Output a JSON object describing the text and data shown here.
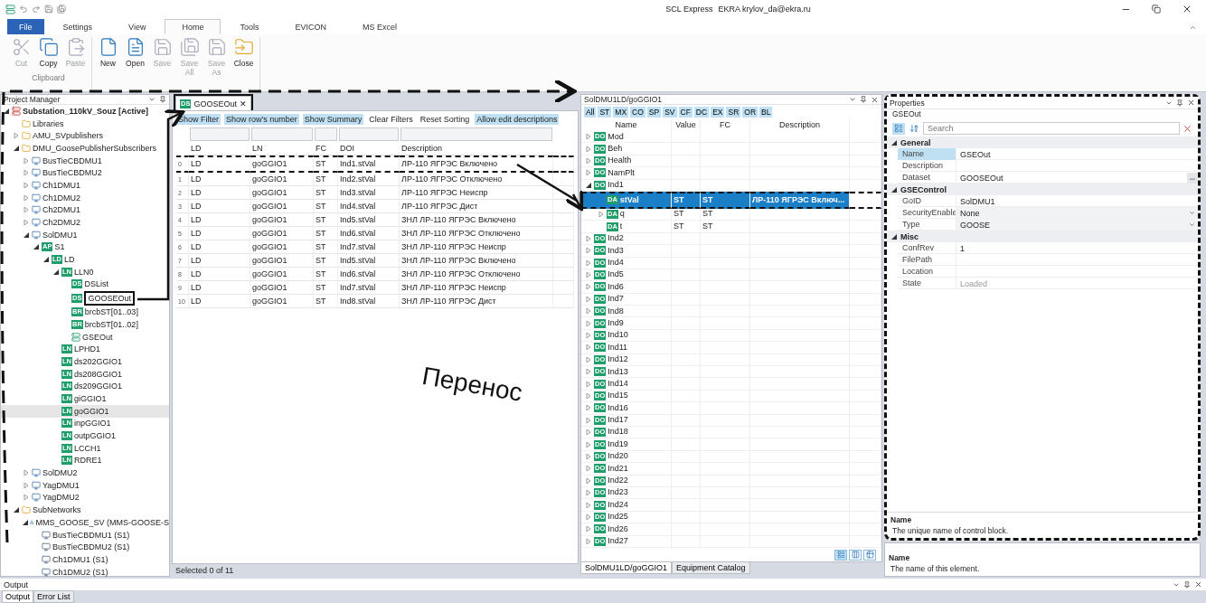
{
  "window": {
    "app": "SCL Express",
    "user": "EKRA krylov_da@ekra.ru"
  },
  "ribbon_tabs": [
    {
      "label": "File",
      "kind": "file",
      "selected": false
    },
    {
      "label": "Settings",
      "kind": "tab",
      "selected": false
    },
    {
      "label": "View",
      "kind": "tab",
      "selected": false
    },
    {
      "label": "Home",
      "kind": "tab",
      "selected": true
    },
    {
      "label": "Tools",
      "kind": "tab",
      "selected": false
    },
    {
      "label": "EVICON",
      "kind": "tab",
      "selected": false
    },
    {
      "label": "MS Excel",
      "kind": "tab",
      "selected": false
    }
  ],
  "ribbon_groups": [
    {
      "label": "Clipboard",
      "buttons": [
        {
          "label": "Cut",
          "kind": "cut",
          "disabled": true
        },
        {
          "label": "Copy",
          "kind": "copy",
          "disabled": false
        },
        {
          "label": "Paste",
          "kind": "paste",
          "disabled": true
        }
      ]
    },
    {
      "buttons": [
        {
          "label": "New",
          "kind": "new",
          "disabled": false
        },
        {
          "label": "Open",
          "kind": "open",
          "disabled": false
        },
        {
          "label": "Save",
          "kind": "save",
          "disabled": true
        },
        {
          "label": "Save All",
          "kind": "saveall",
          "disabled": true
        },
        {
          "label": "Save As",
          "kind": "save",
          "disabled": true
        },
        {
          "label": "Close",
          "kind": "close",
          "disabled": false
        }
      ]
    }
  ],
  "project_manager": {
    "title": "Project Manager",
    "tree": [
      {
        "label": "Substation_110kV_Souz [Active]",
        "kind": "substation",
        "expanded": true,
        "selected": false,
        "children": [
          {
            "label": "Libraries",
            "kind": "folder",
            "selected": false
          },
          {
            "label": "AMU_SVpublishers",
            "kind": "folder",
            "expanded": false,
            "selected": false
          },
          {
            "label": "DMU_GoosePublisherSubscribers",
            "kind": "folder",
            "expanded": true,
            "selected": false,
            "children": [
              {
                "label": "BusTieCBDMU1",
                "kind": "ied",
                "expanded": false,
                "selected": false
              },
              {
                "label": "BusTieCBDMU2",
                "kind": "ied",
                "expanded": false,
                "selected": false
              },
              {
                "label": "Ch1DMU1",
                "kind": "ied",
                "expanded": false,
                "selected": false
              },
              {
                "label": "Ch1DMU2",
                "kind": "ied",
                "expanded": false,
                "selected": false
              },
              {
                "label": "Ch2DMU1",
                "kind": "ied",
                "expanded": false,
                "selected": false
              },
              {
                "label": "Ch2DMU2",
                "kind": "ied",
                "expanded": false,
                "selected": false
              },
              {
                "label": "SolDMU1",
                "kind": "ied",
                "expanded": true,
                "selected": false,
                "children": [
                  {
                    "label": "S1",
                    "badge": "AP",
                    "expanded": true,
                    "selected": false,
                    "children": [
                      {
                        "label": "LD",
                        "badge": "LD",
                        "expanded": true,
                        "selected": false,
                        "children": [
                          {
                            "label": "LLN0",
                            "badge": "LN",
                            "expanded": true,
                            "selected": false,
                            "children": [
                              {
                                "label": "DSList",
                                "badge": "DS",
                                "selected": false
                              },
                              {
                                "label": "GOOSEOut",
                                "badge": "DS",
                                "selected": false,
                                "framed": true
                              },
                              {
                                "label": "brcbST[01..03]",
                                "badge": "BR",
                                "selected": false
                              },
                              {
                                "label": "brcbST[01..02]",
                                "badge": "BR",
                                "selected": false
                              },
                              {
                                "label": "GSEOut",
                                "kind": "gse",
                                "selected": false
                              }
                            ]
                          },
                          {
                            "label": "LPHD1",
                            "badge": "LN",
                            "selected": false
                          },
                          {
                            "label": "ds202GGIO1",
                            "badge": "LN",
                            "selected": false
                          },
                          {
                            "label": "ds208GGIO1",
                            "badge": "LN",
                            "selected": false
                          },
                          {
                            "label": "ds209GGIO1",
                            "badge": "LN",
                            "selected": false
                          },
                          {
                            "label": "giGGIO1",
                            "badge": "LN",
                            "selected": false
                          },
                          {
                            "label": "goGGIO1",
                            "badge": "LN",
                            "selected": true
                          },
                          {
                            "label": "inpGGIO1",
                            "badge": "LN",
                            "selected": false
                          },
                          {
                            "label": "outpGGIO1",
                            "badge": "LN",
                            "selected": false
                          },
                          {
                            "label": "LCCH1",
                            "badge": "LN",
                            "selected": false
                          },
                          {
                            "label": "RDRE1",
                            "badge": "LN",
                            "selected": false
                          }
                        ]
                      }
                    ]
                  }
                ]
              },
              {
                "label": "SolDMU2",
                "kind": "ied",
                "expanded": false,
                "selected": false
              },
              {
                "label": "YagDMU1",
                "kind": "ied",
                "expanded": false,
                "selected": false
              },
              {
                "label": "YagDMU2",
                "kind": "ied",
                "expanded": false,
                "selected": false
              }
            ]
          },
          {
            "label": "SubNetworks",
            "kind": "folder",
            "expanded": true,
            "selected": false,
            "children": [
              {
                "label": "MMS_GOOSE_SV (MMS-GOOSE-S",
                "kind": "network",
                "expanded": true,
                "selected": false,
                "children": [
                  {
                    "label": "BusTieCBDMU1 (S1)",
                    "kind": "device",
                    "selected": false
                  },
                  {
                    "label": "BusTieCBDMU2 (S1)",
                    "kind": "device",
                    "selected": false
                  },
                  {
                    "label": "Ch1DMU1 (S1)",
                    "kind": "device",
                    "selected": false
                  },
                  {
                    "label": "Ch1DMU2 (S1)",
                    "kind": "device",
                    "selected": false
                  }
                ]
              }
            ]
          }
        ]
      }
    ]
  },
  "dataset_document": {
    "tab": {
      "badge": "DS",
      "label": "GOOSEOut",
      "close": "✕",
      "framed": true
    },
    "toolbar": [
      {
        "label": "Show Filter",
        "on": true
      },
      {
        "label": "Show row's number",
        "on": true
      },
      {
        "label": "Show Summary",
        "on": true
      },
      {
        "label": "Clear Filters",
        "on": false
      },
      {
        "label": "Reset Sorting",
        "on": false
      },
      {
        "label": "Allow edit descriptions",
        "on": true
      }
    ],
    "columns": [
      "LD",
      "LN",
      "FC",
      "DOI",
      "Description"
    ],
    "rows": [
      {
        "number": "0",
        "cells": [
          "LD",
          "goGGIO1",
          "ST",
          "Ind1.stVal",
          "ЛР-110 ЯГРЭС Включено"
        ],
        "framed": true
      },
      {
        "number": "1",
        "cells": [
          "LD",
          "goGGIO1",
          "ST",
          "Ind2.stVal",
          "ЛР-110 ЯГРЭС Отключено"
        ]
      },
      {
        "number": "2",
        "cells": [
          "LD",
          "goGGIO1",
          "ST",
          "Ind3.stVal",
          "ЛР-110 ЯГРЭС Неиспр"
        ]
      },
      {
        "number": "3",
        "cells": [
          "LD",
          "goGGIO1",
          "ST",
          "Ind4.stVal",
          "ЛР-110 ЯГРЭС Дист"
        ]
      },
      {
        "number": "4",
        "cells": [
          "LD",
          "goGGIO1",
          "ST",
          "Ind5.stVal",
          "ЗНЛ ЛР-110 ЯГРЭС Включено"
        ]
      },
      {
        "number": "5",
        "cells": [
          "LD",
          "goGGIO1",
          "ST",
          "Ind6.stVal",
          "ЗНЛ ЛР-110 ЯГРЭС Отключено"
        ]
      },
      {
        "number": "6",
        "cells": [
          "LD",
          "goGGIO1",
          "ST",
          "Ind7.stVal",
          "ЗНЛ ЛР-110 ЯГРЭС Неиспр"
        ]
      },
      {
        "number": "7",
        "cells": [
          "LD",
          "goGGIO1",
          "ST",
          "Ind5.stVal",
          "ЗНЛ ЛР-110 ЯГРЭС Включено"
        ]
      },
      {
        "number": "8",
        "cells": [
          "LD",
          "goGGIO1",
          "ST",
          "Ind6.stVal",
          "ЗНЛ ЛР-110 ЯГРЭС Отключено"
        ]
      },
      {
        "number": "9",
        "cells": [
          "LD",
          "goGGIO1",
          "ST",
          "Ind7.stVal",
          "ЗНЛ ЛР-110 ЯГРЭС Неиспр"
        ]
      },
      {
        "number": "10",
        "cells": [
          "LD",
          "goGGIO1",
          "ST",
          "Ind8.stVal",
          "ЗНЛ ЛР-110 ЯГРЭС Дист"
        ]
      }
    ],
    "status": "Selected 0 of 11"
  },
  "node_panel": {
    "title": "SolDMU1LD/goGGIO1",
    "filters": [
      "All",
      "ST",
      "MX",
      "CO",
      "SP",
      "SV",
      "CF",
      "DC",
      "EX",
      "SR",
      "OR",
      "BL"
    ],
    "columns": [
      "Name",
      "Value",
      "FC",
      "Description"
    ],
    "tree": [
      {
        "badge": "DO",
        "name": "Mod",
        "expanded": false,
        "selected": false
      },
      {
        "badge": "DO",
        "name": "Beh",
        "expanded": false,
        "selected": false
      },
      {
        "badge": "DO",
        "name": "Health",
        "expanded": false,
        "selected": false
      },
      {
        "badge": "DO",
        "name": "NamPlt",
        "expanded": false,
        "selected": false
      },
      {
        "badge": "DO",
        "name": "Ind1",
        "expanded": true,
        "selected": false,
        "children": [
          {
            "badge": "DA",
            "name": "stVal",
            "value": "ST",
            "fc": "ST",
            "description": "ЛР-110 ЯГРЭС Включ...",
            "selected": true,
            "framed": true
          },
          {
            "badge": "DA",
            "name": "q",
            "value": "ST",
            "fc": "ST",
            "expanded": false,
            "selected": false
          },
          {
            "badge": "DA",
            "name": "t",
            "value": "ST",
            "fc": "ST",
            "selected": false
          }
        ]
      },
      {
        "badge": "DO",
        "name": "Ind2",
        "expanded": false,
        "selected": false
      },
      {
        "badge": "DO",
        "name": "Ind3",
        "expanded": false,
        "selected": false
      },
      {
        "badge": "DO",
        "name": "Ind4",
        "expanded": false,
        "selected": false
      },
      {
        "badge": "DO",
        "name": "Ind5",
        "expanded": false,
        "selected": false
      },
      {
        "badge": "DO",
        "name": "Ind6",
        "expanded": false,
        "selected": false
      },
      {
        "badge": "DO",
        "name": "Ind7",
        "expanded": false,
        "selected": false
      },
      {
        "badge": "DO",
        "name": "Ind8",
        "expanded": false,
        "selected": false
      },
      {
        "badge": "DO",
        "name": "Ind9",
        "expanded": false,
        "selected": false
      },
      {
        "badge": "DO",
        "name": "Ind10",
        "expanded": false,
        "selected": false
      },
      {
        "badge": "DO",
        "name": "Ind11",
        "expanded": false,
        "selected": false
      },
      {
        "badge": "DO",
        "name": "Ind12",
        "expanded": false,
        "selected": false
      },
      {
        "badge": "DO",
        "name": "Ind13",
        "expanded": false,
        "selected": false
      },
      {
        "badge": "DO",
        "name": "Ind14",
        "expanded": false,
        "selected": false
      },
      {
        "badge": "DO",
        "name": "Ind15",
        "expanded": false,
        "selected": false
      },
      {
        "badge": "DO",
        "name": "Ind16",
        "expanded": false,
        "selected": false
      },
      {
        "badge": "DO",
        "name": "Ind17",
        "expanded": false,
        "selected": false
      },
      {
        "badge": "DO",
        "name": "Ind18",
        "expanded": false,
        "selected": false
      },
      {
        "badge": "DO",
        "name": "Ind19",
        "expanded": false,
        "selected": false
      },
      {
        "badge": "DO",
        "name": "Ind20",
        "expanded": false,
        "selected": false
      },
      {
        "badge": "DO",
        "name": "Ind21",
        "expanded": false,
        "selected": false
      },
      {
        "badge": "DO",
        "name": "Ind22",
        "expanded": false,
        "selected": false
      },
      {
        "badge": "DO",
        "name": "Ind23",
        "expanded": false,
        "selected": false
      },
      {
        "badge": "DO",
        "name": "Ind24",
        "expanded": false,
        "selected": false
      },
      {
        "badge": "DO",
        "name": "Ind25",
        "expanded": false,
        "selected": false
      },
      {
        "badge": "DO",
        "name": "Ind26",
        "expanded": false,
        "selected": false
      },
      {
        "badge": "DO",
        "name": "Ind27",
        "expanded": false,
        "selected": false
      }
    ],
    "views": [
      {
        "kind": "list",
        "selected": true
      },
      {
        "kind": "columns",
        "selected": false
      },
      {
        "kind": "grid",
        "selected": false
      }
    ],
    "bottom_tabs": [
      {
        "label": "SolDMU1LD/goGGIO1",
        "selected": true
      },
      {
        "label": "Equipment Catalog",
        "selected": false
      }
    ]
  },
  "properties": {
    "title": "Properties",
    "object": "GSEOut",
    "framed": true,
    "sort_modes": [
      {
        "kind": "categorized",
        "selected": true
      },
      {
        "kind": "alphabetical",
        "selected": false
      }
    ],
    "search": {
      "placeholder": "Search"
    },
    "categories": [
      {
        "name": "General",
        "expanded": true,
        "props": [
          {
            "name": "Name",
            "value": "GSEOut",
            "kind": "text",
            "selected": true
          },
          {
            "name": "Description",
            "kind": "text",
            "selected": false
          },
          {
            "name": "Dataset",
            "value": "GOOSEOut",
            "kind": "ellipsis",
            "selected": false
          }
        ]
      },
      {
        "name": "GSEControl",
        "expanded": true,
        "props": [
          {
            "name": "GoID",
            "value": "SolDMU1",
            "kind": "text",
            "selected": false
          },
          {
            "name": "SecurityEnable",
            "value": "None",
            "kind": "dropdown",
            "selected": false
          },
          {
            "name": "Type",
            "value": "GOOSE",
            "kind": "dropdown",
            "selected": false
          }
        ]
      },
      {
        "name": "Misc",
        "expanded": true,
        "props": [
          {
            "name": "ConfRev",
            "value": "1",
            "kind": "text",
            "selected": false
          },
          {
            "name": "FilePath",
            "kind": "text",
            "selected": false
          },
          {
            "name": "Location",
            "kind": "text",
            "selected": false
          },
          {
            "name": "State",
            "value": "Loaded",
            "kind": "readonly",
            "selected": false
          }
        ]
      }
    ],
    "help": {
      "title": "Name",
      "text": "The unique name of control block."
    }
  },
  "element_help": {
    "title": "Name",
    "text": "The name of this element."
  },
  "output": {
    "title": "Output",
    "tabs": [
      {
        "label": "Output",
        "selected": true
      },
      {
        "label": "Error List",
        "selected": false
      }
    ]
  },
  "annotation": {
    "label": "Перенос"
  }
}
